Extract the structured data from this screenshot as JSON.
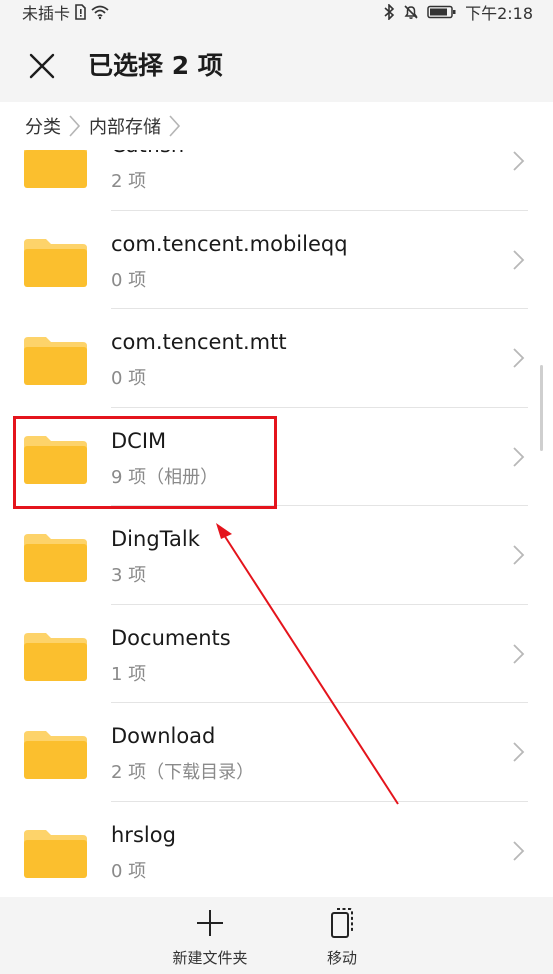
{
  "status_bar": {
    "carrier": "未插卡",
    "time": "下午2:18"
  },
  "title_bar": {
    "title": "已选择 2 项"
  },
  "breadcrumb": {
    "items": [
      "分类",
      "内部存储"
    ]
  },
  "folders": [
    {
      "name": "Catfish",
      "count": "2 项"
    },
    {
      "name": "com.tencent.mobileqq",
      "count": "0 项"
    },
    {
      "name": "com.tencent.mtt",
      "count": "0 项"
    },
    {
      "name": "DCIM",
      "count": "9 项（相册）"
    },
    {
      "name": "DingTalk",
      "count": "3 项"
    },
    {
      "name": "Documents",
      "count": "1 项"
    },
    {
      "name": "Download",
      "count": "2 项（下载目录）"
    },
    {
      "name": "hrslog",
      "count": "0 项"
    }
  ],
  "bottom_bar": {
    "new_folder_label": "新建文件夹",
    "move_label": "移动"
  },
  "colors": {
    "folder_yellow": "#fbbf2e",
    "folder_tab": "#fdd36a",
    "highlight_red": "#e4141c"
  },
  "icons": {
    "close": "close-icon",
    "breadcrumb_separator": "chevron-right-icon",
    "folder": "folder-icon",
    "row_chevron": "chevron-right-icon",
    "new_folder": "plus-icon",
    "move": "move-icon"
  }
}
